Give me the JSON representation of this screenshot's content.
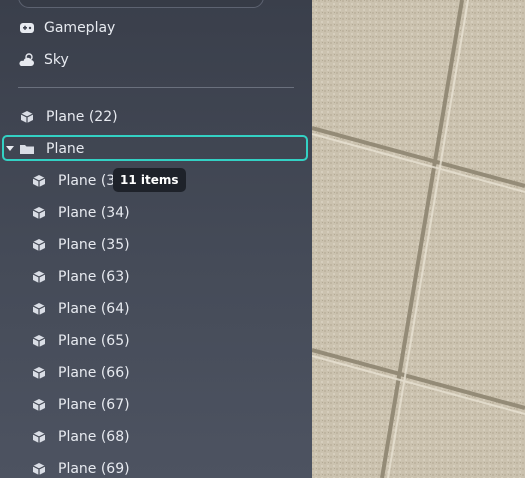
{
  "sidebar": {
    "top_items": [
      {
        "label": "Gameplay",
        "icon": "gamepad-icon"
      },
      {
        "label": "Sky",
        "icon": "cloud-sun-icon"
      }
    ],
    "tree": {
      "root_item": {
        "label": "Plane (22)",
        "icon": "cube-icon"
      },
      "group": {
        "label": "Plane",
        "icon": "folder-icon",
        "expanded": true,
        "selected": true
      },
      "children": [
        {
          "label": "Plane (32)"
        },
        {
          "label": "Plane (34)"
        },
        {
          "label": "Plane (35)"
        },
        {
          "label": "Plane (63)"
        },
        {
          "label": "Plane (64)"
        },
        {
          "label": "Plane (65)"
        },
        {
          "label": "Plane (66)"
        },
        {
          "label": "Plane (67)"
        },
        {
          "label": "Plane (68)"
        },
        {
          "label": "Plane (69)"
        }
      ]
    },
    "tooltip": "11 items"
  },
  "colors": {
    "selection_outline": "#33d1c4",
    "panel_bg": "#3f4450",
    "tile": "#c9c0ad",
    "grout": "#8a826f"
  }
}
